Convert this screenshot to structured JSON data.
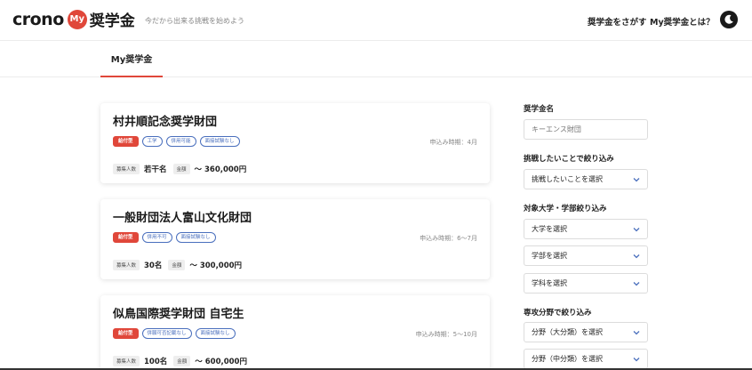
{
  "header": {
    "logo_crono": "crono",
    "logo_my": "My",
    "logo_shogaku": "奨学金",
    "tagline": "今だから出来る挑戦を始めよう",
    "nav_search": "奨学金をさがす",
    "nav_about": "My奨学金とは？",
    "theme_icon": "moon-icon"
  },
  "tabs": {
    "my_scholarship": "My奨学金"
  },
  "cards": [
    {
      "title": "村井順記念奨学財団",
      "type_tag": "給付型",
      "tags": [
        "工学",
        "併用可能",
        "面接試験なし"
      ],
      "period": "申込み時期：4月",
      "recruit_label": "募集人数",
      "recruit_value": "若干名",
      "amount_label": "金額",
      "amount_value": "〜 360,000円"
    },
    {
      "title": "一般財団法人富山文化財団",
      "type_tag": "給付型",
      "tags": [
        "併用不可",
        "面接試験なし"
      ],
      "period": "申込み時期：6〜7月",
      "recruit_label": "募集人数",
      "recruit_value": "30名",
      "amount_label": "金額",
      "amount_value": "〜 300,000円"
    },
    {
      "title": "似鳥国際奨学財団 自宅生",
      "type_tag": "給付型",
      "tags": [
        "併願可否記載なし",
        "面接試験なし"
      ],
      "period": "申込み時期：5〜10月",
      "recruit_label": "募集人数",
      "recruit_value": "100名",
      "amount_label": "金額",
      "amount_value": "〜 600,000円"
    }
  ],
  "sidebar": {
    "name_heading": "奨学金名",
    "name_placeholder": "キーエンス財団",
    "challenge_heading": "挑戦したいことで絞り込み",
    "challenge_select": "挑戦したいことを選択",
    "univ_heading": "対象大学・学部絞り込み",
    "univ_select": "大学を選択",
    "faculty_select": "学部を選択",
    "dept_select": "学科を選択",
    "field_heading": "専攻分野で絞り込み",
    "field_major_select": "分野（大分類）を選択",
    "field_middle_select": "分野（中分類）を選択"
  }
}
